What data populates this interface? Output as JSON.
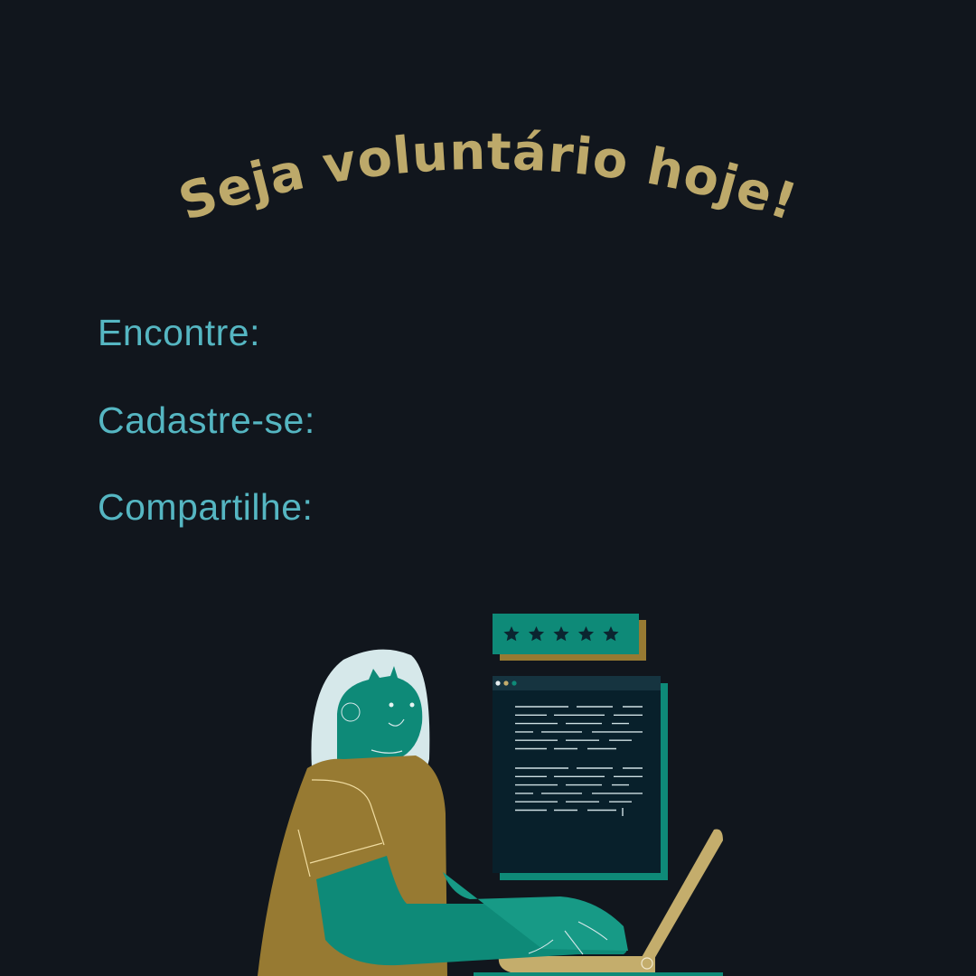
{
  "headline": "Seja voluntário hoje!",
  "items": [
    "Encontre:",
    "Cadastre-se:",
    "Compartilhe:"
  ],
  "rating": {
    "stars": 5
  },
  "colors": {
    "background": "#11161d",
    "headline": "#bda96a",
    "items": "#55b6c2",
    "teal": "#0e8a78",
    "mustard": "#977a32",
    "sand": "#c4ad6c",
    "hair": "#d6e8ea"
  }
}
